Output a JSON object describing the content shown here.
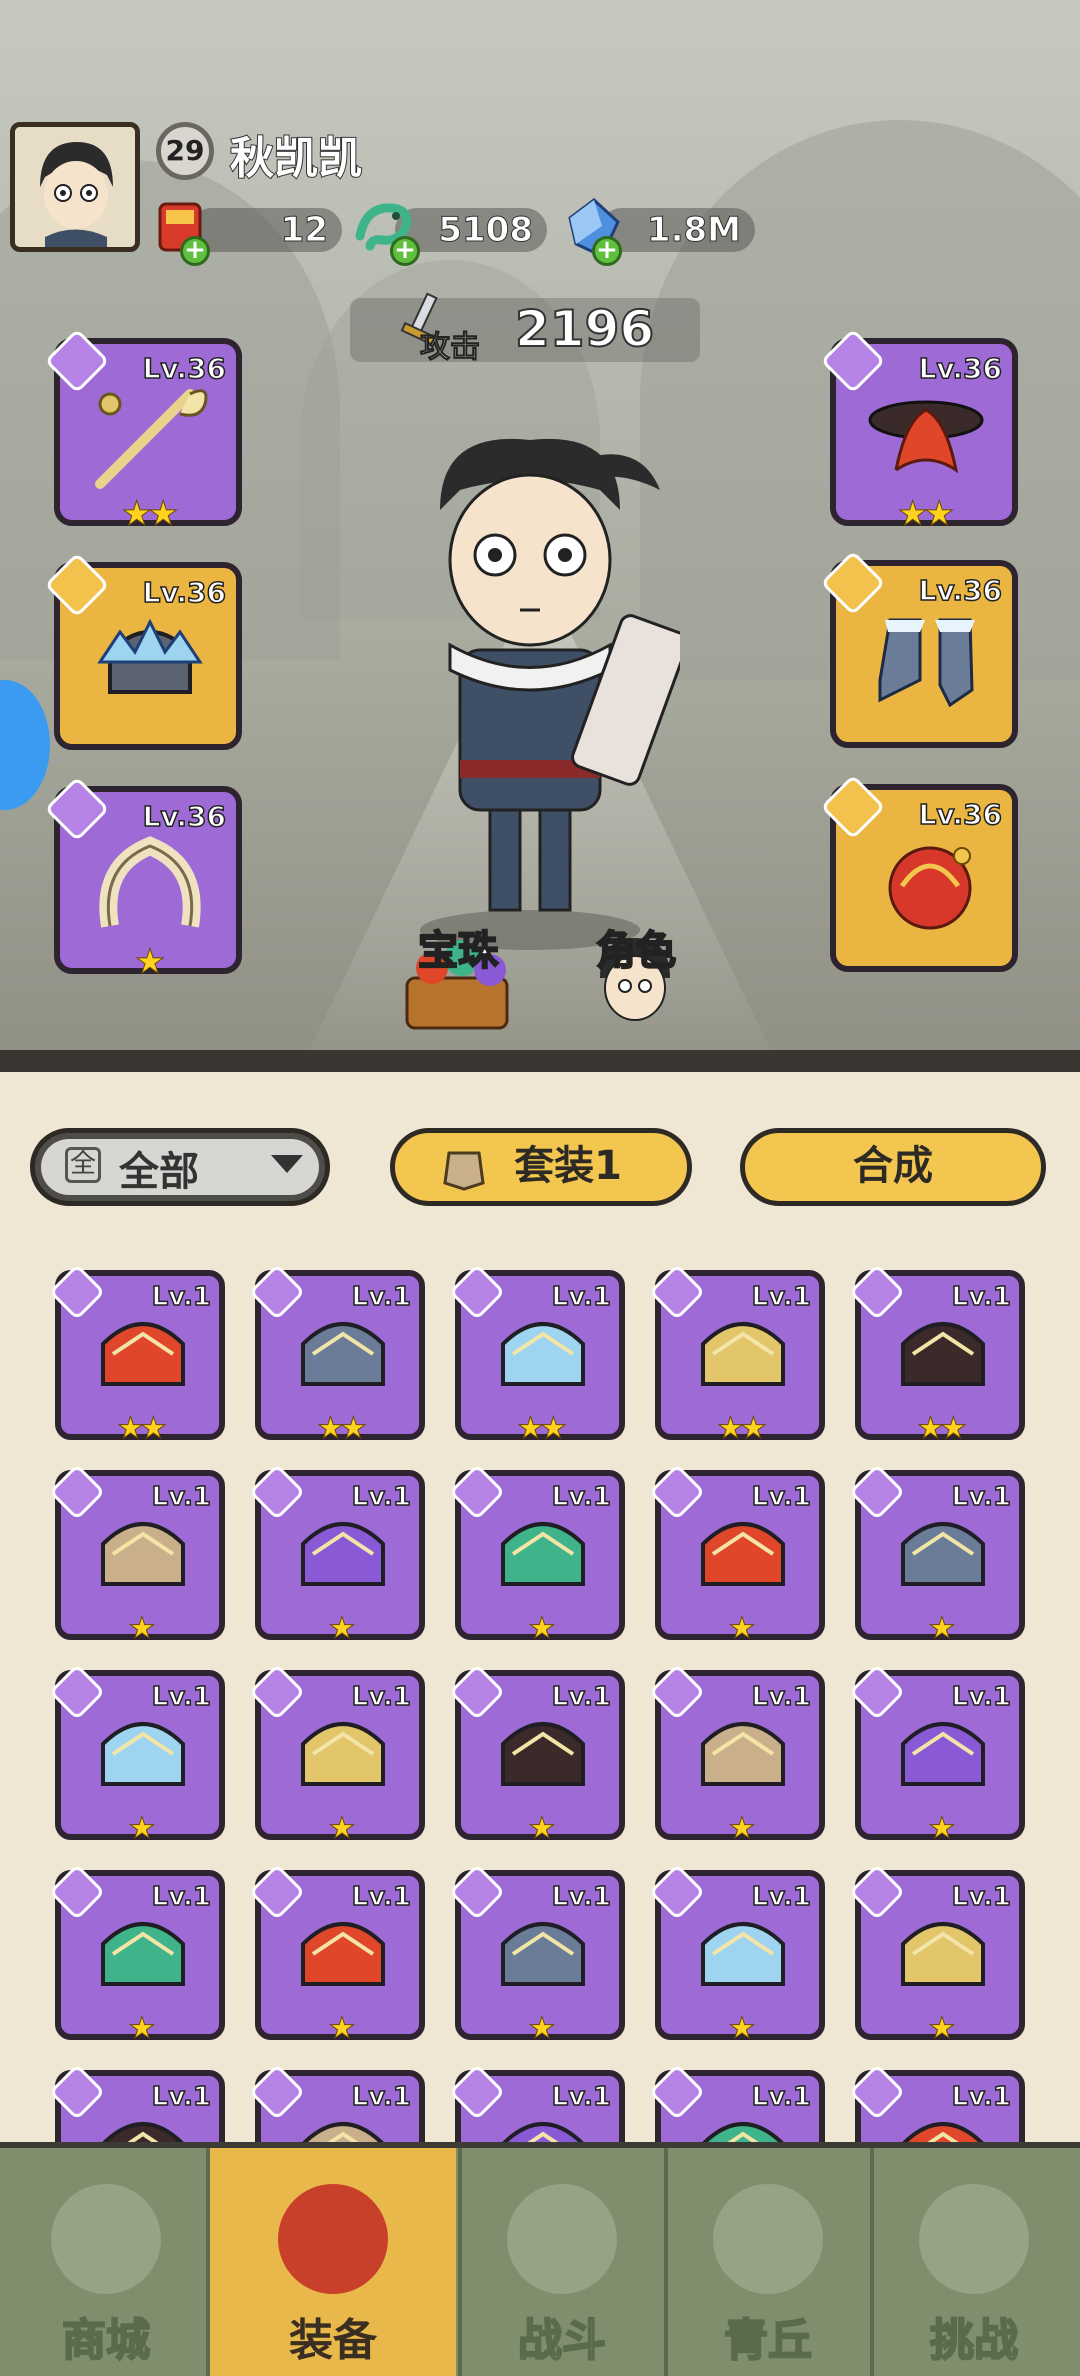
{
  "player": {
    "level": "29",
    "name": "秋凯凯"
  },
  "currencies": [
    {
      "name": "red-envelope",
      "value": "12"
    },
    {
      "name": "jade-dragon",
      "value": "5108"
    },
    {
      "name": "blue-crystal",
      "value": "1.8M"
    }
  ],
  "attack": {
    "label": "攻击",
    "value": "2196"
  },
  "equipped": {
    "left": [
      {
        "type": "weapon",
        "level": "Lv.36",
        "stars": "★★",
        "rarity": "purple"
      },
      {
        "type": "helmet",
        "level": "Lv.36",
        "stars": "",
        "rarity": "gold"
      },
      {
        "type": "necklace",
        "level": "Lv.36",
        "stars": "★",
        "rarity": "purple"
      }
    ],
    "right": [
      {
        "type": "belt",
        "level": "Lv.36",
        "stars": "★★",
        "rarity": "purple"
      },
      {
        "type": "boots",
        "level": "Lv.36",
        "stars": "",
        "rarity": "gold"
      },
      {
        "type": "orb",
        "level": "Lv.36",
        "stars": "",
        "rarity": "gold"
      }
    ]
  },
  "scene_buttons": {
    "gems": "宝珠",
    "role": "角色"
  },
  "filter": {
    "icon_text": "全",
    "label": "全部"
  },
  "set_button": {
    "label": "套装1"
  },
  "synth_button": {
    "label": "合成"
  },
  "inventory": [
    [
      {
        "level": "Lv.1",
        "stars": "★★"
      },
      {
        "level": "Lv.1",
        "stars": "★★"
      },
      {
        "level": "Lv.1",
        "stars": "★★"
      },
      {
        "level": "Lv.1",
        "stars": "★★"
      },
      {
        "level": "Lv.1",
        "stars": "★★"
      }
    ],
    [
      {
        "level": "Lv.1",
        "stars": "★"
      },
      {
        "level": "Lv.1",
        "stars": "★"
      },
      {
        "level": "Lv.1",
        "stars": "★"
      },
      {
        "level": "Lv.1",
        "stars": "★"
      },
      {
        "level": "Lv.1",
        "stars": "★"
      }
    ],
    [
      {
        "level": "Lv.1",
        "stars": "★"
      },
      {
        "level": "Lv.1",
        "stars": "★"
      },
      {
        "level": "Lv.1",
        "stars": "★"
      },
      {
        "level": "Lv.1",
        "stars": "★"
      },
      {
        "level": "Lv.1",
        "stars": "★"
      }
    ],
    [
      {
        "level": "Lv.1",
        "stars": "★"
      },
      {
        "level": "Lv.1",
        "stars": "★"
      },
      {
        "level": "Lv.1",
        "stars": "★"
      },
      {
        "level": "Lv.1",
        "stars": "★"
      },
      {
        "level": "Lv.1",
        "stars": "★"
      }
    ],
    [
      {
        "level": "Lv.1",
        "stars": ""
      },
      {
        "level": "Lv.1",
        "stars": ""
      },
      {
        "level": "Lv.1",
        "stars": ""
      },
      {
        "level": "Lv.1",
        "stars": ""
      },
      {
        "level": "Lv.1",
        "stars": ""
      }
    ]
  ],
  "nav": [
    {
      "label": "商城",
      "icon": "shop-icon",
      "active": false
    },
    {
      "label": "装备",
      "icon": "helmet-icon",
      "active": true
    },
    {
      "label": "战斗",
      "icon": "crossed-swords-icon",
      "active": false
    },
    {
      "label": "青丘",
      "icon": "mountain-icon",
      "active": false
    },
    {
      "label": "挑战",
      "icon": "challenge-orb-icon",
      "active": false
    }
  ],
  "colors": {
    "purple_slot": "#9e6bd6",
    "gold_slot": "#eab641",
    "nav_bg": "#7f8f6e",
    "nav_active": "#e9b84a",
    "panel_bg": "#efe6d4"
  }
}
